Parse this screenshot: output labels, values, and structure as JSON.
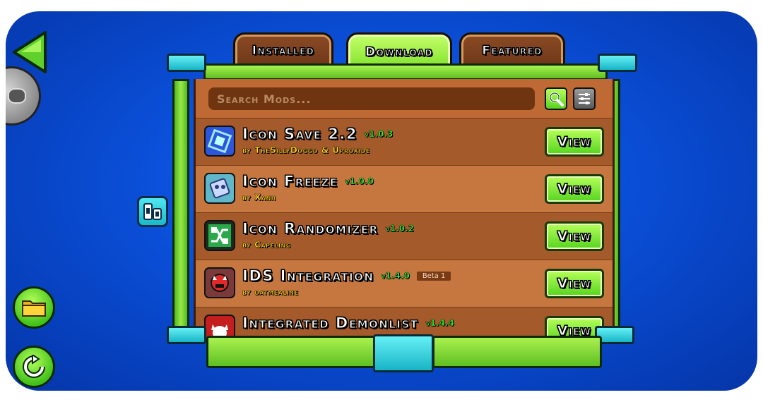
{
  "tabs": [
    {
      "label": "Installed",
      "active": false
    },
    {
      "label": "Download",
      "active": true
    },
    {
      "label": "Featured",
      "active": false
    }
  ],
  "search": {
    "placeholder": "Search Mods..."
  },
  "mods": [
    {
      "name": "Icon Save 2.2",
      "version": "v1.0.3",
      "author": "by TheSillyDoggo & Uproxide",
      "badge": "",
      "button": "View",
      "logo_color": "#2b56d9"
    },
    {
      "name": "Icon Freeze",
      "version": "v1.0.0",
      "author": "by Xanii",
      "badge": "",
      "button": "View",
      "logo_color": "#5fb7c9"
    },
    {
      "name": "Icon Randomizer",
      "version": "v1.0.2",
      "author": "by Capeling",
      "badge": "",
      "button": "View",
      "logo_color": "#2aa84a"
    },
    {
      "name": "IDS Integration",
      "version": "v1.4.0",
      "author": "by oatmealine",
      "badge": "Beta 1",
      "button": "View",
      "logo_color": "#c83a3a"
    },
    {
      "name": "Integrated Demonlist",
      "version": "v1.4.4",
      "author": "",
      "badge": "",
      "button": "View",
      "logo_color": "#c41e1e"
    }
  ],
  "colors": {
    "accent_green": "#7fe12c",
    "tab_brown": "#8b4a25",
    "background_blue": "#0a4fd8",
    "cyan": "#18b4c6"
  }
}
